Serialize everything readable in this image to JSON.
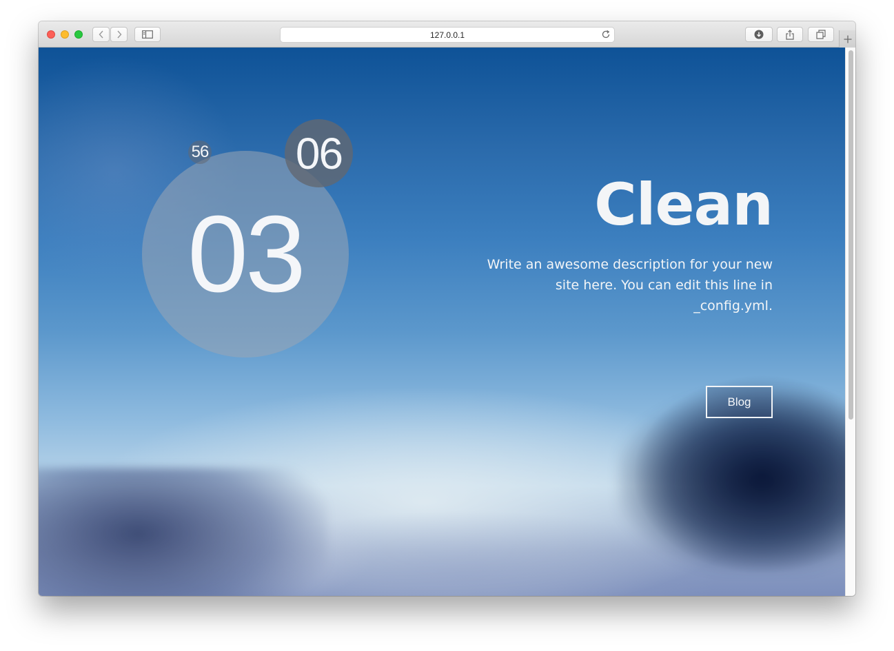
{
  "browser": {
    "url": "127.0.0.1",
    "icons": {
      "back": "chevron-left-icon",
      "forward": "chevron-right-icon",
      "sidebar": "sidebar-icon",
      "reload": "reload-icon",
      "downloads": "download-icon",
      "share": "share-icon",
      "tabs": "tabs-icon",
      "new_tab": "plus-icon"
    }
  },
  "clock": {
    "hours": "03",
    "minutes": "06",
    "seconds": "56"
  },
  "hero": {
    "title": "Clean",
    "description": "Write an awesome description for your new site here. You can edit this line in _config.yml.",
    "blog_button": "Blog"
  },
  "colors": {
    "text": "#f3f5f7",
    "sky_top": "#0e5297",
    "sky_horizon": "#bcd6ea"
  }
}
